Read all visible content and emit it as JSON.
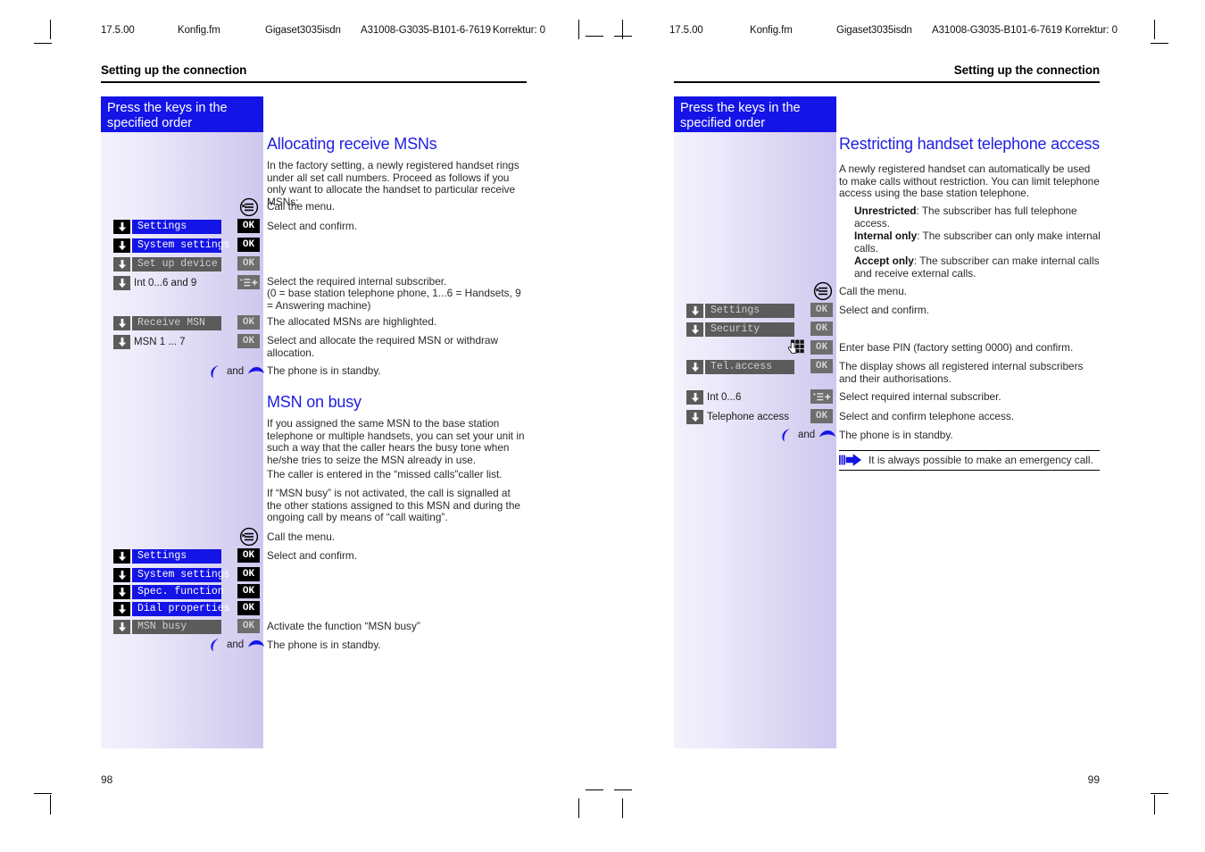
{
  "meta": {
    "running_head": [
      "17.5.00",
      "Konfig.fm",
      "Gigaset3035isdn",
      "A31008-G3035-B101-6-7619",
      "Korrektur: 0"
    ]
  },
  "left_page": {
    "section_header": "Setting up the connection",
    "folio": "98",
    "banner": "Press the keys in the specified order",
    "title_1": "Allocating receive MSNs",
    "para_1": "In the factory setting, a newly registered handset rings under all set call numbers. Proceed as follows if you only want to allocate the handset to particular receive MSNs:",
    "step_call_menu": "Call the menu.",
    "step_select_confirm": "Select and confirm.",
    "step_subscriber_1": "Select the required internal subscriber.",
    "step_subscriber_2": "(0 = base station telephone phone, 1...6 = Handsets, 9 = Answering machine)",
    "step_highlighted": "The allocated MSNs are highlighted.",
    "step_allocate": "Select and allocate the required MSN or withdraw allocation.",
    "step_standby": "The phone is in standby.",
    "title_2": "MSN on busy",
    "para_2": "If you assigned the same MSN to the base station telephone or multiple handsets, you can set your unit in such a way that the caller hears the busy tone when he/she tries to seize the MSN already in use.",
    "para_3": "The caller is entered in the “missed calls”caller list.",
    "para_4": "If “MSN busy” is not activated, the call is signalled at the other stations assigned to this MSN and during the ongoing call by means of “call waiting”.",
    "step_call_menu_2": "Call the menu.",
    "step_select_confirm_2": "Select and confirm.",
    "step_activate": "Activate the function “MSN busy”",
    "step_standby_2": "The phone is in standby.",
    "keys_group_1": [
      {
        "label": "Settings",
        "style": "blue",
        "action": "OK",
        "action_style": "black"
      },
      {
        "label": "System settings",
        "style": "blue",
        "action": "OK",
        "action_style": "black"
      },
      {
        "label": "Set up device",
        "style": "gray",
        "action": "OK",
        "action_style": "gray"
      },
      {
        "label": "Int 0...6 and 9",
        "style": "plain",
        "action": "list",
        "action_style": "gray"
      }
    ],
    "keys_group_2": [
      {
        "label": "Receive MSN",
        "style": "gray",
        "action": "OK",
        "action_style": "gray"
      },
      {
        "label": "MSN 1 ... 7",
        "style": "plain",
        "action": "OK",
        "action_style": "gray"
      }
    ],
    "keys_group_3": [
      {
        "label": "Settings",
        "style": "blue",
        "action": "OK",
        "action_style": "black"
      },
      {
        "label": "System settings",
        "style": "blue",
        "action": "OK",
        "action_style": "black"
      },
      {
        "label": "Spec. function",
        "style": "blue",
        "action": "OK",
        "action_style": "black"
      },
      {
        "label": "Dial properties",
        "style": "blue",
        "action": "OK",
        "action_style": "black"
      },
      {
        "label": "MSN busy",
        "style": "gray",
        "action": "OK",
        "action_style": "gray"
      }
    ],
    "hook_label": "and"
  },
  "right_page": {
    "section_header": "Setting up the connection",
    "folio": "99",
    "banner": "Press the keys in the specified order",
    "title_1": "Restricting handset telephone access",
    "para_1": "A newly registered handset can automatically be used to make calls without restriction. You can limit telephone access using the base station telephone.",
    "bullets": [
      {
        "term": "Unrestricted",
        "text": ": The subscriber has full telephone access."
      },
      {
        "term": "Internal only",
        "text": ": The subscriber can only make internal calls."
      },
      {
        "term": "Accept only",
        "text": ": The subscriber can make internal calls and receive external calls."
      }
    ],
    "step_call_menu": "Call the menu.",
    "step_select_confirm": "Select and confirm.",
    "step_pin": "Enter base PIN (factory setting 0000) and confirm.",
    "step_display": "The display shows all registered internal subscribers and their authorisations.",
    "step_subscriber": "Select required internal subscriber.",
    "step_telaccess": "Select and confirm telephone access.",
    "step_standby": "The phone is in standby.",
    "note": "It is always possible to make an emergency call.",
    "keys_group_1": [
      {
        "label": "Settings",
        "style": "gray",
        "action": "OK",
        "action_style": "gray"
      },
      {
        "label": "Security",
        "style": "gray",
        "action": "OK",
        "action_style": "gray"
      },
      {
        "label": "",
        "style": "pad",
        "action": "OK",
        "action_style": "gray"
      },
      {
        "label": "Tel.access",
        "style": "gray",
        "action": "OK",
        "action_style": "gray"
      }
    ],
    "keys_group_2": [
      {
        "label": "Int 0...6",
        "style": "plain",
        "action": "list",
        "action_style": "gray"
      },
      {
        "label": "Telephone access",
        "style": "plain",
        "action": "OK",
        "action_style": "gray"
      }
    ],
    "hook_label": "and"
  },
  "colors": {
    "accent_blue": "#1414e6",
    "title_blue": "#2020e0",
    "key_gray": "#5b5b5b",
    "key_black": "#000000"
  }
}
